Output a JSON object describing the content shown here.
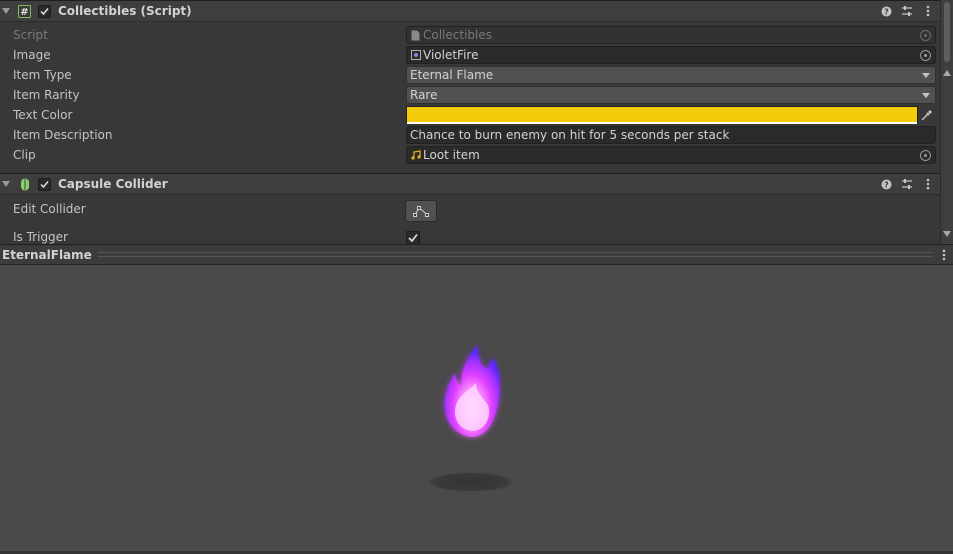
{
  "components": [
    {
      "title": "Collectibles (Script)",
      "icon": "script-icon",
      "enabled": true,
      "fields": [
        {
          "label": "Script",
          "value": "Collectibles",
          "type": "object",
          "disabled": true
        },
        {
          "label": "Image",
          "value": "VioletFire",
          "type": "object"
        },
        {
          "label": "Item Type",
          "value": "Eternal Flame",
          "type": "dropdown"
        },
        {
          "label": "Item Rarity",
          "value": "Rare",
          "type": "dropdown"
        },
        {
          "label": "Text Color",
          "value": "#F5CC0A",
          "type": "color"
        },
        {
          "label": "Item Description",
          "value": "Chance to burn enemy on hit for 5 seconds per stack",
          "type": "text"
        },
        {
          "label": "Clip",
          "value": "Loot item",
          "type": "object"
        }
      ]
    },
    {
      "title": "Capsule Collider",
      "icon": "capsule-collider-icon",
      "enabled": true,
      "fields": [
        {
          "label": "Edit Collider",
          "type": "button"
        },
        {
          "label": "Is Trigger",
          "value": true,
          "type": "checkbox"
        }
      ]
    }
  ],
  "preview": {
    "title": "EternalFlame"
  },
  "colors": {
    "accent_yellow": "#F5CC0A",
    "flame_core": "#FFD8FF",
    "flame_glow": "#E040FF",
    "flame_edge": "#6A2BFF"
  }
}
